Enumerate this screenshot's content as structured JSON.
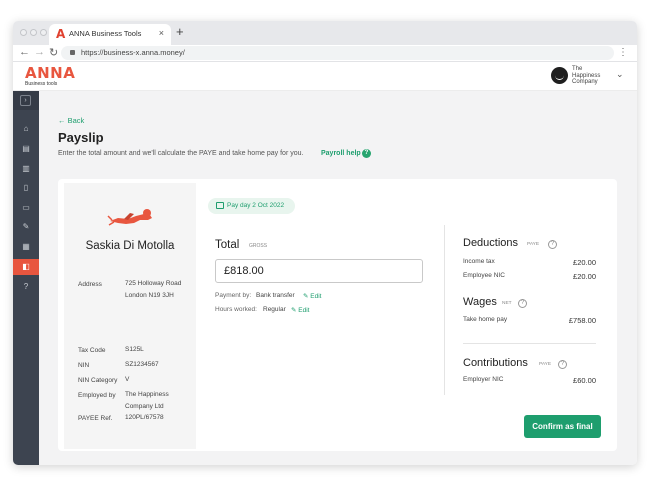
{
  "browser": {
    "tab_title": "ANNA Business Tools",
    "tab_logo": "A",
    "tab_close": "×",
    "new_tab": "+",
    "url": "https://business-x.anna.money/",
    "nav_back": "←",
    "nav_forward": "→",
    "nav_reload": "↻",
    "menu": "⋮"
  },
  "header": {
    "logo": "ANNA",
    "logo_sub": "Business tools",
    "company": "The Happiness Company",
    "chevron": "⌄"
  },
  "sidebar": {
    "toggle": "›",
    "items": [
      {
        "icon": "home-icon",
        "glyph": "⌂"
      },
      {
        "icon": "invoice-icon",
        "glyph": "▤"
      },
      {
        "icon": "bin-icon",
        "glyph": "▥"
      },
      {
        "icon": "book-icon",
        "glyph": "▯"
      },
      {
        "icon": "document-icon",
        "glyph": "▭"
      },
      {
        "icon": "pencil-icon",
        "glyph": "✎"
      },
      {
        "icon": "calendar-icon",
        "glyph": "▦"
      },
      {
        "icon": "wallet-icon",
        "glyph": "◧"
      },
      {
        "icon": "help-icon",
        "glyph": "?"
      }
    ]
  },
  "page": {
    "back": "← Back",
    "title": "Payslip",
    "subtitle": "Enter the total amount and we'll calculate the PAYE and take home pay for you.",
    "payroll_help": "Payroll help",
    "help_glyph": "?"
  },
  "employee": {
    "name": "Saskia Di Motolla",
    "rows": [
      {
        "label": "Address",
        "value": "725 Holloway Road London N19 3JH"
      },
      {
        "label": "Tax Code",
        "value": "S125L"
      },
      {
        "label": "NIN",
        "value": "SZ1234567"
      },
      {
        "label": "NIN Category",
        "value": "V"
      },
      {
        "label": "Employed by",
        "value": "The Happiness Company Ltd"
      },
      {
        "label": "PAYEE Ref.",
        "value": "120PL/67578"
      }
    ]
  },
  "payslip": {
    "pay_day": "Pay day 2 Oct 2022",
    "total_label": "Total",
    "total_tag": "GROSS",
    "total_value": "£818.00",
    "payment_by_label": "Payment by:",
    "payment_by_value": "Bank transfer",
    "hours_label": "Hours worked:",
    "hours_value": "Regular",
    "edit_label": "✎ Edit"
  },
  "deductions": {
    "title": "Deductions",
    "tag": "PAYE",
    "items": [
      {
        "label": "Income tax",
        "value": "£20.00"
      },
      {
        "label": "Employee NIC",
        "value": "£20.00"
      }
    ]
  },
  "wages": {
    "title": "Wages",
    "tag": "NET",
    "items": [
      {
        "label": "Take home pay",
        "value": "£758.00"
      }
    ]
  },
  "contributions": {
    "title": "Contributions",
    "tag": "PAYE",
    "items": [
      {
        "label": "Employer NIC",
        "value": "£60.00"
      }
    ]
  },
  "actions": {
    "confirm": "Confirm as final"
  },
  "colors": {
    "brand": "#e8563f",
    "accent": "#1e9e6e",
    "sidebar": "#3d4450"
  }
}
